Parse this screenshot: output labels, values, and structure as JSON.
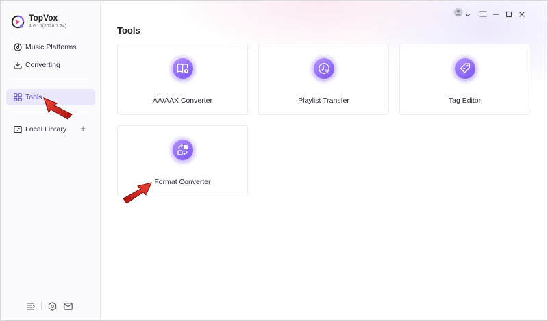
{
  "app": {
    "name": "TopVox",
    "version": "4.0.10(2026.7.24)"
  },
  "sidebar": {
    "items": [
      {
        "label": "Music Platforms",
        "icon": "music-disc-icon"
      },
      {
        "label": "Converting",
        "icon": "download-tray-icon"
      },
      {
        "label": "Tools",
        "icon": "grid-icon",
        "active": true
      },
      {
        "label": "Local Library",
        "icon": "folder-music-icon",
        "action": "+"
      }
    ],
    "footer_icons": [
      "queue-list-icon",
      "settings-hex-icon",
      "mail-icon"
    ]
  },
  "main": {
    "title": "Tools",
    "tools": [
      {
        "label": "AA/AAX Converter",
        "icon": "book-convert-icon"
      },
      {
        "label": "Playlist Transfer",
        "icon": "music-transfer-icon"
      },
      {
        "label": "Tag Editor",
        "icon": "tag-icon"
      },
      {
        "label": "Format Converter",
        "icon": "format-convert-icon"
      }
    ]
  },
  "window_controls": [
    "avatar-icon",
    "chevron-down-icon",
    "menu-icon",
    "minimize-icon",
    "maximize-icon",
    "close-icon"
  ],
  "colors": {
    "accent": "#7a52f0",
    "active_bg": "#ebe7fb",
    "arrow": "#d0201a"
  }
}
